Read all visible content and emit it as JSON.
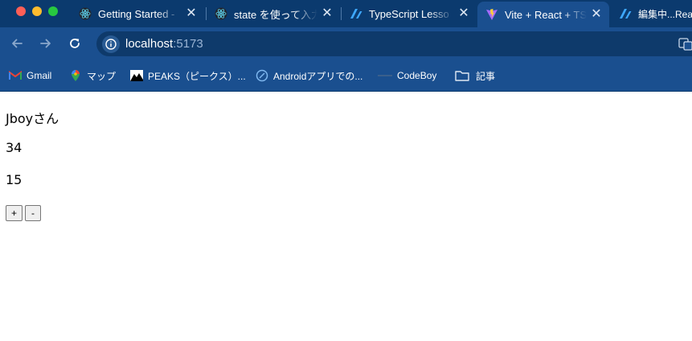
{
  "browser": {
    "tabs": [
      {
        "title": "Getting Started -",
        "icon": "react-icon",
        "active": false
      },
      {
        "title": "state を使って入力",
        "icon": "react-icon",
        "active": false
      },
      {
        "title": "TypeScript Lesso",
        "icon": "zenn-icon",
        "active": false
      },
      {
        "title": "Vite + React + TS",
        "icon": "vite-icon",
        "active": true
      },
      {
        "title": "編集中...React",
        "icon": "zenn-icon",
        "active": false
      }
    ],
    "close_glyph": "✕",
    "address": {
      "host": "localhost",
      "port": ":5173"
    },
    "bookmarks": [
      {
        "label": "Gmail",
        "icon": "gmail-icon"
      },
      {
        "label": "マップ",
        "icon": "maps-icon"
      },
      {
        "label": "PEAKS（ピークス）...",
        "icon": "peaks-icon"
      },
      {
        "label": "Androidアプリでの...",
        "icon": "compass-icon"
      },
      {
        "label": "CodeBoy",
        "icon": "codeboy-icon"
      },
      {
        "label": "記事",
        "icon": "folder-icon"
      }
    ]
  },
  "app": {
    "name_line": "Jboyさん",
    "age": "34",
    "count": "15",
    "increment_label": "+",
    "decrement_label": "-"
  }
}
